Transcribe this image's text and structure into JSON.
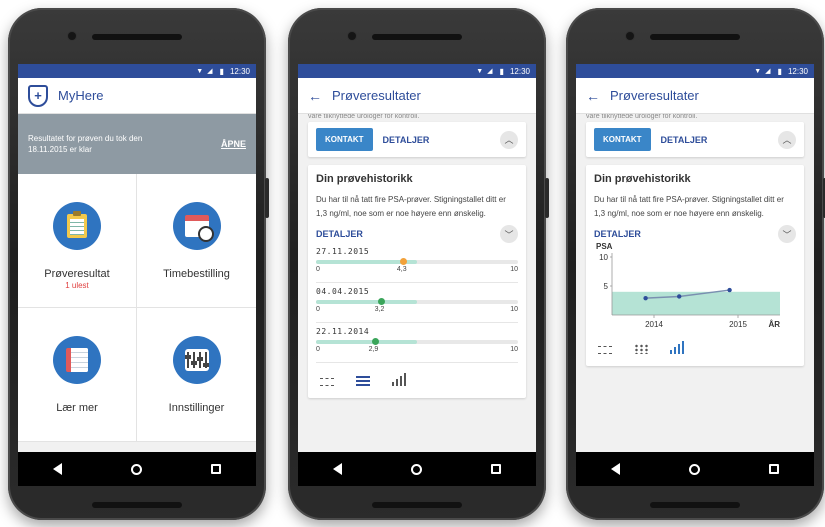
{
  "status": {
    "time": "12:30"
  },
  "screen1": {
    "app_name": "MyHere",
    "notification_text": "Resultatet for prøven du tok den 18.11.2015 er klar",
    "notification_action": "ÅPNE",
    "tiles": [
      {
        "label": "Prøveresultat",
        "sub": "1 ulest",
        "icon": "clipboard-icon"
      },
      {
        "label": "Timebestilling",
        "sub": "",
        "icon": "calendar-clock-icon"
      },
      {
        "label": "Lær mer",
        "sub": "",
        "icon": "book-icon"
      },
      {
        "label": "Innstillinger",
        "sub": "",
        "icon": "sliders-icon"
      }
    ]
  },
  "results": {
    "title": "Prøveresultater",
    "cut_text": "våre tilknyttede urologer for kontroll.",
    "contact_label": "KONTAKT",
    "details_label": "DETALJER",
    "history_title": "Din prøvehistorikk",
    "history_text": "Du har til nå tatt fire PSA-prøver. Stigningstallet ditt er 1,3 ng/ml, noe som er noe høyere enn ønskelig.",
    "history_details": "DETALJER"
  },
  "entries": [
    {
      "date": "27.11.2015",
      "value": 4.3,
      "value_label": "4,3",
      "min": "0",
      "max": "10",
      "dot_color": "#f2a13a"
    },
    {
      "date": "04.04.2015",
      "value": 3.2,
      "value_label": "3,2",
      "min": "0",
      "max": "10",
      "dot_color": "#3aa55a"
    },
    {
      "date": "22.11.2014",
      "value": 2.9,
      "value_label": "2,9",
      "min": "0",
      "max": "10",
      "dot_color": "#3aa55a"
    }
  ],
  "chart_data": {
    "type": "line",
    "ylabel": "PSA",
    "xlabel": "ÅR",
    "ylim": [
      0,
      10
    ],
    "yticks": [
      "10",
      "5"
    ],
    "xticks": [
      "2014",
      "2015"
    ],
    "band": [
      0,
      4
    ],
    "series": [
      {
        "values": [
          {
            "x": 2013.9,
            "y": 2.9
          },
          {
            "x": 2014.3,
            "y": 3.2
          },
          {
            "x": 2014.9,
            "y": 4.3
          }
        ]
      }
    ],
    "colors": {
      "line": "#7a8fb0",
      "points": "#2e4d9a",
      "band": "#b5e3d5"
    }
  }
}
